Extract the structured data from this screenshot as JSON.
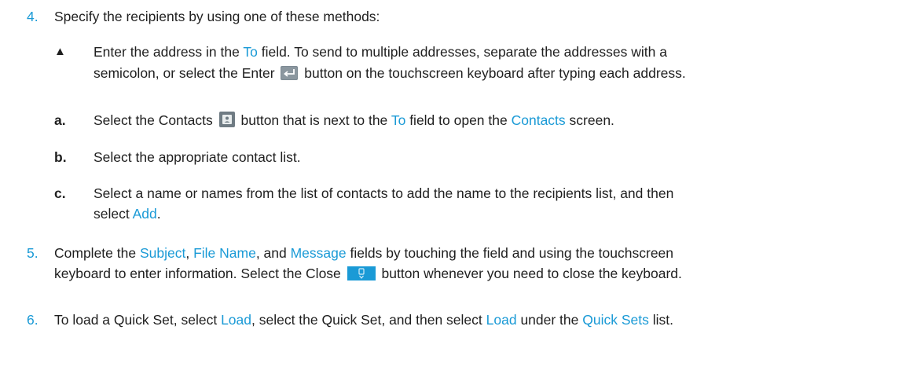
{
  "steps": [
    {
      "number": "4.",
      "text": "Specify the recipients by using one of these methods:"
    },
    {
      "number": "5.",
      "line1": {
        "pre": "Complete the ",
        "subject": "Subject",
        "sep1": ", ",
        "file_name": "File Name",
        "sep2": ", and ",
        "message": "Message",
        "post": " fields by touching the field and using the touchscreen"
      },
      "line2": {
        "pre": "keyboard to enter information. Select the Close",
        "post": "button whenever you need to close the keyboard."
      }
    },
    {
      "number": "6.",
      "line": {
        "pre": "To load a Quick Set, select ",
        "load1": "Load",
        "mid1": ", select the Quick Set, and then select ",
        "load2": "Load",
        "mid2": " under the ",
        "quick_sets": "Quick Sets",
        "post": " list."
      }
    }
  ],
  "bullet": {
    "marker": "▲",
    "line1": {
      "pre": "Enter the address in the ",
      "to": "To",
      "post": " field. To send to multiple addresses, separate the addresses with a"
    },
    "line2": {
      "pre": "semicolon, or select the Enter",
      "post": "button on the touchscreen keyboard after typing each address."
    }
  },
  "substeps": [
    {
      "marker": "a.",
      "pre": "Select the Contacts",
      "mid": "button that is next to the ",
      "to": "To",
      "mid2": " field to open the ",
      "contacts": "Contacts",
      "post": " screen."
    },
    {
      "marker": "b.",
      "text": "Select the appropriate contact list."
    },
    {
      "marker": "c.",
      "line1": "Select a name or names from the list of contacts to add the name to the recipients list, and then",
      "line2_pre": "select ",
      "add": "Add",
      "line2_post": "."
    }
  ],
  "icons": {
    "enter": "enter-key-icon",
    "contacts": "contacts-icon",
    "close_keyboard": "close-keyboard-icon"
  },
  "colors": {
    "text": "#1f1f1f",
    "link": "#1a9ad6"
  }
}
